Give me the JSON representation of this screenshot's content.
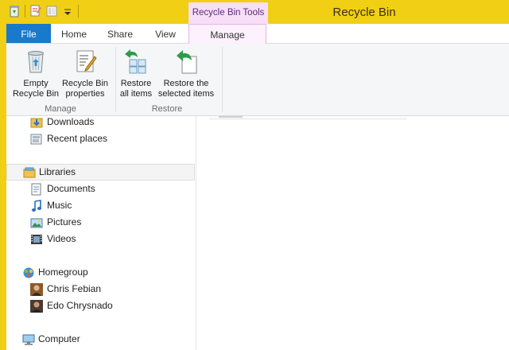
{
  "window": {
    "title": "Recycle Bin"
  },
  "quick_access": {
    "icons": [
      "recycle-bin-small-icon",
      "properties-icon",
      "new-folder-icon",
      "customize-dropdown-icon"
    ]
  },
  "context_tab": {
    "header": "Recycle Bin Tools"
  },
  "tabs": {
    "file": "File",
    "home": "Home",
    "share": "Share",
    "view": "View",
    "manage": "Manage"
  },
  "ribbon": {
    "manage_group": {
      "label": "Manage",
      "empty": {
        "line1": "Empty",
        "line2": "Recycle Bin"
      },
      "properties": {
        "line1": "Recycle Bin",
        "line2": "properties"
      }
    },
    "restore_group": {
      "label": "Restore",
      "restore_all": {
        "line1": "Restore",
        "line2": "all items"
      },
      "restore_selected": {
        "line1": "Restore the",
        "line2": "selected items"
      }
    }
  },
  "nav": {
    "downloads": "Downloads",
    "recent": "Recent places",
    "libraries": "Libraries",
    "documents": "Documents",
    "music": "Music",
    "pictures": "Pictures",
    "videos": "Videos",
    "homegroup": "Homegroup",
    "user1": "Chris Febian",
    "user2": "Edo Chrysnado",
    "computer": "Computer"
  },
  "colors": {
    "titlebar": "#f0cf14",
    "file_tab": "#1979ca",
    "context_tab": "#f7dff7",
    "restore_arrow": "#2e9b4a"
  }
}
